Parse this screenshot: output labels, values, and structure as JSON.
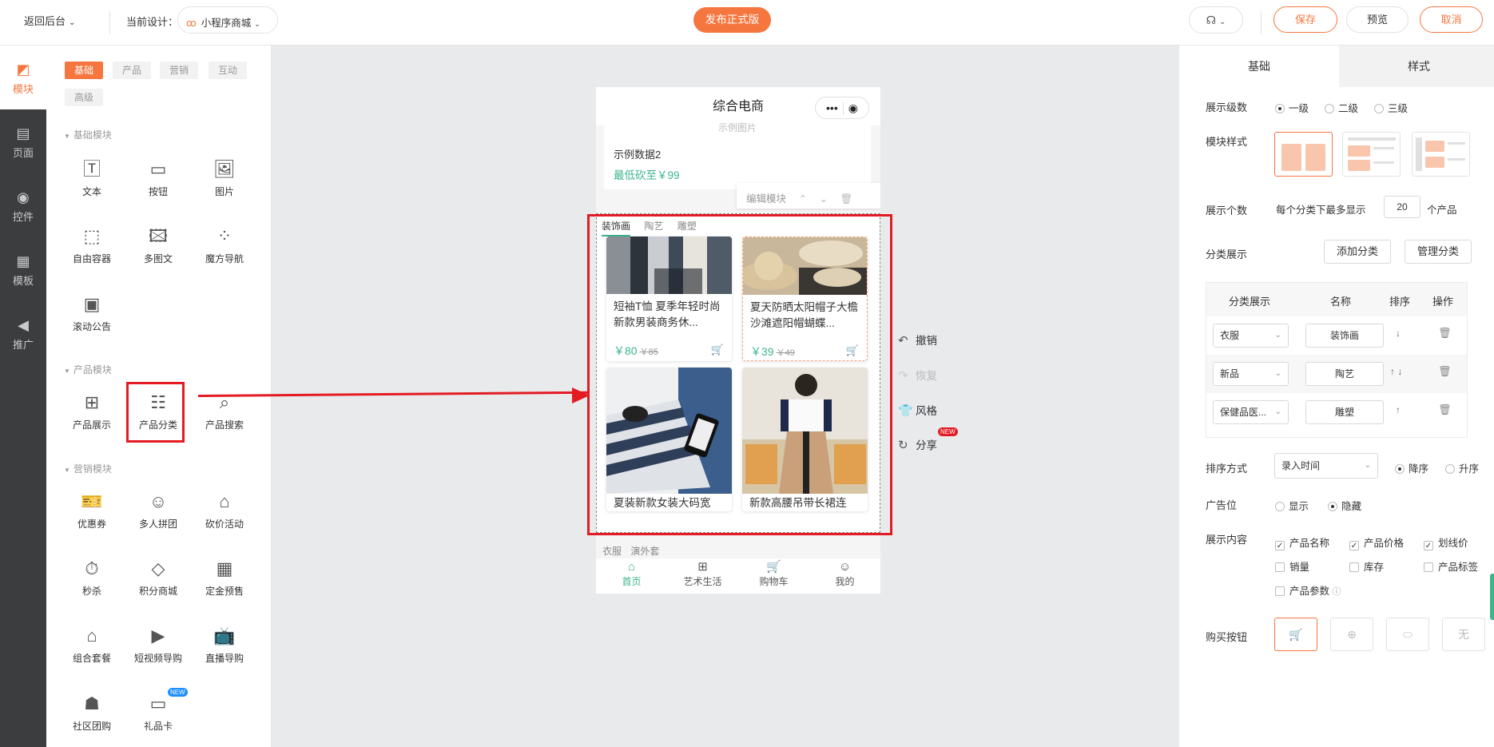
{
  "topbar": {
    "back_label": "返回后台",
    "current_design_label": "当前设计：",
    "design_name": "小程序商城",
    "publish_label": "发布正式版",
    "save_label": "保存",
    "preview_label": "预览",
    "cancel_label": "取消"
  },
  "rail": {
    "items": [
      {
        "label": "模块",
        "icon": "module-icon"
      },
      {
        "label": "页面",
        "icon": "page-icon"
      },
      {
        "label": "控件",
        "icon": "toggle-icon"
      },
      {
        "label": "模板",
        "icon": "template-icon"
      },
      {
        "label": "推广",
        "icon": "megaphone-icon"
      }
    ]
  },
  "module_panel": {
    "tabs": [
      "基础",
      "产品",
      "营销",
      "互动",
      "高级"
    ],
    "sections": {
      "basic": "基础模块",
      "product": "产品模块",
      "marketing": "营销模块"
    },
    "basic_modules": [
      "文本",
      "按钮",
      "图片",
      "自由容器",
      "多图文",
      "魔方导航",
      "滚动公告"
    ],
    "product_modules": [
      "产品展示",
      "产品分类",
      "产品搜索"
    ],
    "marketing_modules": [
      "优惠券",
      "多人拼团",
      "砍价活动",
      "秒杀",
      "积分商城",
      "定金预售",
      "组合套餐",
      "短视频导购",
      "直播导购",
      "社区团购",
      "礼品卡"
    ],
    "new_badge": "NEW"
  },
  "phone": {
    "title": "综合电商",
    "prev_cut_text": "示例图片",
    "prev_item_name": "示例数据2",
    "prev_item_price": "最低砍至￥99",
    "edit_module_label": "编辑模块",
    "category_tabs": [
      "装饰画",
      "陶艺",
      "雕塑"
    ],
    "products": [
      {
        "name": "短袖T恤 夏季年轻时尚新款男装商务休...",
        "price": "￥80",
        "old_price": "￥85"
      },
      {
        "name": "夏天防晒太阳帽子大檐沙滩遮阳帽蝴蝶...",
        "price": "￥39",
        "old_price": "￥49"
      },
      {
        "name": "夏装新款女装大码宽",
        "price": "",
        "old_price": ""
      },
      {
        "name": "新款高腰吊带长裙连",
        "price": "",
        "old_price": ""
      }
    ],
    "bottom_cut_tabs": [
      "衣服",
      "演外套"
    ],
    "tabbar": [
      {
        "label": "首页",
        "icon": "home-icon"
      },
      {
        "label": "艺术生活",
        "icon": "grid-icon"
      },
      {
        "label": "购物车",
        "icon": "cart-icon"
      },
      {
        "label": "我的",
        "icon": "user-icon"
      }
    ]
  },
  "side_actions": {
    "undo": "撤销",
    "redo": "恢复",
    "style": "风格",
    "share": "分享",
    "share_badge": "NEW"
  },
  "right_panel": {
    "tabs": [
      "基础",
      "样式"
    ],
    "display_level_label": "展示级数",
    "levels": [
      "一级",
      "二级",
      "三级"
    ],
    "module_style_label": "模块样式",
    "display_count_label": "展示个数",
    "display_count_prefix": "每个分类下最多显示",
    "display_count_value": "20",
    "display_count_suffix": "个产品",
    "category_display_label": "分类展示",
    "add_category": "添加分类",
    "manage_category": "管理分类",
    "table_headers": [
      "分类展示",
      "名称",
      "排序",
      "操作"
    ],
    "rows": [
      {
        "category": "衣服",
        "name": "装饰画",
        "sort": "↓"
      },
      {
        "category": "新品",
        "name": "陶艺",
        "sort": "↑ ↓"
      },
      {
        "category": "保健品医...",
        "name": "雕塑",
        "sort": "↑"
      }
    ],
    "sort_method_label": "排序方式",
    "sort_method_value": "录入时间",
    "sort_desc": "降序",
    "sort_asc": "升序",
    "ad_label": "广告位",
    "ad_show": "显示",
    "ad_hide": "隐藏",
    "content_label": "展示内容",
    "content_options": [
      {
        "label": "产品名称",
        "checked": true
      },
      {
        "label": "产品价格",
        "checked": true
      },
      {
        "label": "划线价",
        "checked": true
      },
      {
        "label": "销量",
        "checked": false
      },
      {
        "label": "库存",
        "checked": false
      },
      {
        "label": "产品标签",
        "checked": false
      },
      {
        "label": "产品参数",
        "checked": false
      }
    ],
    "buy_button_label": "购买按钮",
    "buy_none": "无"
  },
  "colors": {
    "accent": "#f5773f",
    "green": "#3cb58a",
    "highlight_red": "#e31b23"
  }
}
